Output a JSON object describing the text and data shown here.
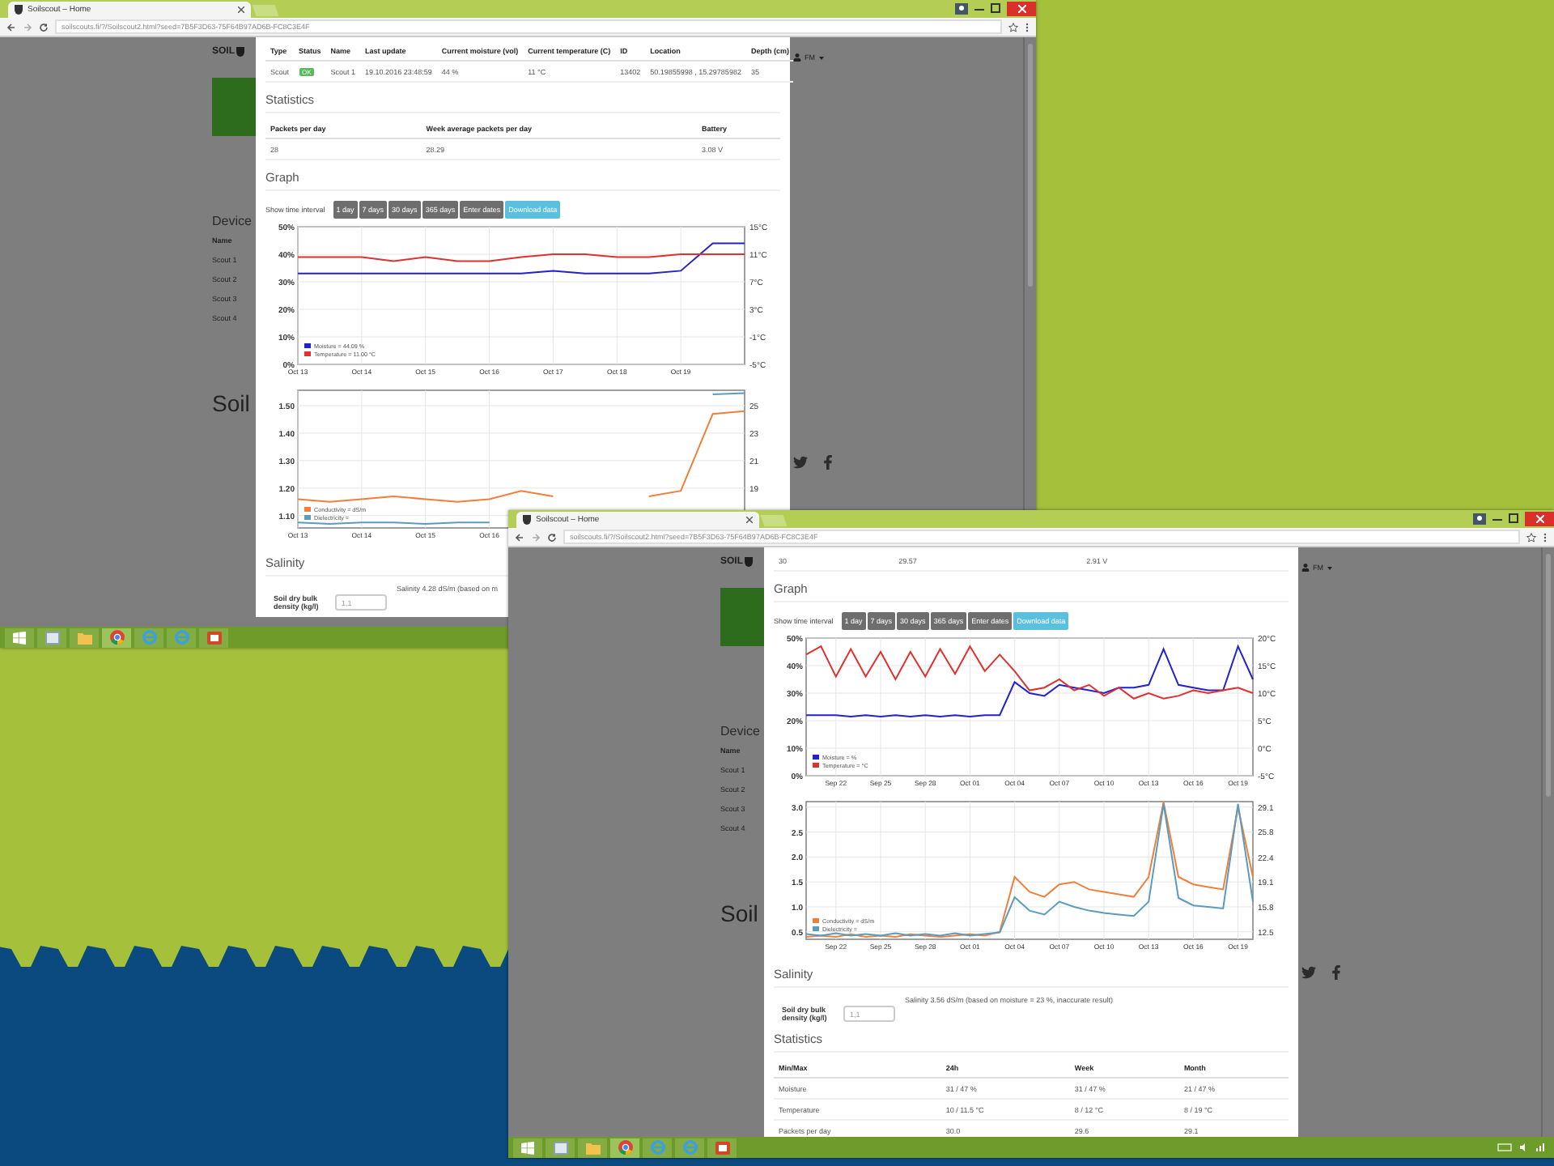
{
  "windows": [
    {
      "tab_title": "Soilscout – Home",
      "url": "soilscouts.fi/?/Soilscout2.html?seed=7B5F3D63-75F64B97AD6B-FC8C3E4F",
      "page": {
        "logo": "SOIL",
        "devices_heading": "Device",
        "devices_column": "Name",
        "devices": [
          "Scout 1",
          "Scout 2",
          "Scout 3",
          "Scout 4"
        ],
        "footer_title": "Soil",
        "user": "FM"
      },
      "modal": [
        {
          "kind": "table",
          "columns": [
            {
              "label": "Type",
              "kind": "text"
            },
            {
              "label": "Status",
              "kind": "badge"
            },
            {
              "label": "Name",
              "kind": "text"
            },
            {
              "label": "Last update",
              "kind": "text"
            },
            {
              "label": "Current moisture (vol)",
              "kind": "text"
            },
            {
              "label": "Current temperature (C)",
              "kind": "text"
            },
            {
              "label": "ID",
              "kind": "text"
            },
            {
              "label": "Location",
              "kind": "text"
            },
            {
              "label": "Depth (cm)",
              "kind": "text"
            }
          ],
          "rows": [
            [
              "Scout",
              "OK",
              "Scout 1",
              "19.10.2016 23:48:59",
              "44 %",
              "11 °C",
              "13402",
              "50.19855998 , 15.29785982",
              "35"
            ]
          ]
        },
        {
          "kind": "heading",
          "text": "Statistics"
        },
        {
          "kind": "table",
          "columns": [
            {
              "label": "Packets per day",
              "kind": "text"
            },
            {
              "label": "Week average packets per day",
              "kind": "text"
            },
            {
              "label": "Battery",
              "kind": "text"
            }
          ],
          "rows": [
            [
              "28",
              "28.29",
              "3.08 V"
            ]
          ]
        },
        {
          "kind": "heading",
          "text": "Graph"
        },
        {
          "kind": "interval",
          "label": "Show time interval",
          "buttons": [
            {
              "label": "1 day",
              "kind": "time"
            },
            {
              "label": "7 days",
              "kind": "time"
            },
            {
              "label": "30 days",
              "kind": "time"
            },
            {
              "label": "365 days",
              "kind": "time"
            },
            {
              "label": "Enter dates",
              "kind": "time"
            },
            {
              "label": "Download data",
              "kind": "download"
            }
          ]
        },
        {
          "kind": "chart",
          "chart_data": {
            "type": "line",
            "categories": [
              "Oct 13",
              null,
              "Oct 14",
              null,
              "Oct 15",
              null,
              "Oct 16",
              null,
              "Oct 17",
              null,
              "Oct 18",
              null,
              "Oct 19",
              null,
              null
            ],
            "grid": true,
            "legend": "lower left",
            "ylim": [
              0,
              50
            ],
            "yticks": [
              {
                "value": 0,
                "label": "0%"
              },
              {
                "value": 10,
                "label": "10%"
              },
              {
                "value": 20,
                "label": "20%"
              },
              {
                "value": 30,
                "label": "30%"
              },
              {
                "value": 40,
                "label": "40%"
              },
              {
                "value": 50,
                "label": "50%"
              }
            ],
            "y2lim": [
              -5,
              15
            ],
            "y2ticks": [
              {
                "value": -5,
                "label": "-5°C"
              },
              {
                "value": -1,
                "label": "-1°C"
              },
              {
                "value": 3,
                "label": "3°C"
              },
              {
                "value": 7,
                "label": "7°C"
              },
              {
                "value": 11,
                "label": "11°C"
              },
              {
                "value": 15,
                "label": "15°C"
              }
            ],
            "series": [
              {
                "name": "Moisture = 44.09 %",
                "color": "#2222cc",
                "values": [
                  33,
                  33,
                  33,
                  33,
                  33,
                  33,
                  33,
                  33,
                  34,
                  33,
                  33,
                  33,
                  34,
                  44,
                  44
                ]
              },
              {
                "name": "Temperature = 11.00 °C",
                "color": "#e03030",
                "axis": "y2",
                "values": [
                  10.6,
                  10.6,
                  10.6,
                  10.0,
                  10.6,
                  10.0,
                  10.0,
                  10.6,
                  11.0,
                  11.0,
                  10.6,
                  10.6,
                  11.0,
                  11.0,
                  11.0
                ]
              }
            ]
          }
        },
        {
          "kind": "chart",
          "chart_data": {
            "type": "line",
            "categories": [
              "Oct 13",
              null,
              "Oct 14",
              null,
              "Oct 15",
              null,
              "Oct 16",
              null,
              null,
              null,
              null,
              null,
              null,
              null,
              null
            ],
            "grid": true,
            "legend": "lower left",
            "ylim": [
              1.055,
              1.556
            ],
            "yticks": [
              {
                "value": 1.1,
                "label": "1.10"
              },
              {
                "value": 1.2,
                "label": "1.20"
              },
              {
                "value": 1.3,
                "label": "1.30"
              },
              {
                "value": 1.4,
                "label": "1.40"
              },
              {
                "value": 1.5,
                "label": "1.50"
              }
            ],
            "y2lim": [
              16.1,
              26.1
            ],
            "y2ticks": [
              {
                "value": 19,
                "label": "19"
              },
              {
                "value": 21,
                "label": "21"
              },
              {
                "value": 23,
                "label": "23"
              },
              {
                "value": 25,
                "label": "25"
              }
            ],
            "series": [
              {
                "name": "Conductivity = dS/m",
                "color": "#f07f3c",
                "values": [
                  1.16,
                  1.15,
                  1.16,
                  1.17,
                  1.16,
                  1.15,
                  1.16,
                  1.19,
                  1.17,
                  null,
                  null,
                  1.17,
                  1.19,
                  1.47,
                  1.48
                ]
              },
              {
                "name": "Dielectricity =",
                "color": "#5b9bbd",
                "axis": "y2",
                "values": [
                  16.5,
                  16.4,
                  16.5,
                  16.5,
                  16.4,
                  16.5,
                  16.5,
                  null,
                  null,
                  null,
                  null,
                  null,
                  null,
                  25.8,
                  25.9
                ]
              }
            ]
          }
        },
        {
          "kind": "heading",
          "text": "Salinity"
        },
        {
          "kind": "salinity",
          "result": "Salinity 4.28 dS/m (based on m",
          "density_label": "Soil dry bulk density (kg/l)",
          "density_value": "1,1"
        }
      ],
      "taskbar": {
        "apps": [
          {
            "kind": "start",
            "selected": false
          },
          {
            "kind": "explorer",
            "selected": false
          },
          {
            "kind": "folder",
            "selected": false
          },
          {
            "kind": "chrome",
            "selected": true
          },
          {
            "kind": "ie",
            "selected": false
          },
          {
            "kind": "ie",
            "selected": false
          },
          {
            "kind": "slides",
            "selected": false
          }
        ]
      }
    },
    {
      "tab_title": "Soilscout – Home",
      "url": "soilscouts.fi/?/Soilscout2.html?seed=7B5F3D63-75F64B97AD6B-FC8C3E4F",
      "page": {
        "logo": "SOIL",
        "devices_heading": "Device",
        "devices_column": "Name",
        "devices": [
          "Scout 1",
          "Scout 2",
          "Scout 3",
          "Scout 4"
        ],
        "footer_title": "Soil",
        "user": "FM"
      },
      "modal": [
        {
          "kind": "table",
          "rows": [
            [
              "30",
              "29.57",
              "2.91 V"
            ]
          ]
        },
        {
          "kind": "heading",
          "text": "Graph"
        },
        {
          "kind": "interval",
          "label": "Show time interval",
          "buttons": [
            {
              "label": "1 day",
              "kind": "time"
            },
            {
              "label": "7 days",
              "kind": "time"
            },
            {
              "label": "30 days",
              "kind": "time"
            },
            {
              "label": "365 days",
              "kind": "time"
            },
            {
              "label": "Enter dates",
              "kind": "time"
            },
            {
              "label": "Download data",
              "kind": "download"
            }
          ]
        },
        {
          "kind": "chart",
          "chart_data": {
            "type": "line",
            "categories": [
              null,
              null,
              "Sep 22",
              null,
              null,
              "Sep 25",
              null,
              null,
              "Sep 28",
              null,
              null,
              "Oct 01",
              null,
              null,
              "Oct 04",
              null,
              null,
              "Oct 07",
              null,
              null,
              "Oct 10",
              null,
              null,
              "Oct 13",
              null,
              null,
              "Oct 16",
              null,
              null,
              "Oct 19",
              null
            ],
            "grid": true,
            "legend": "lower left",
            "ylim": [
              0,
              50
            ],
            "yticks": [
              {
                "value": 0,
                "label": "0%"
              },
              {
                "value": 10,
                "label": "10%"
              },
              {
                "value": 20,
                "label": "20%"
              },
              {
                "value": 30,
                "label": "30%"
              },
              {
                "value": 40,
                "label": "40%"
              },
              {
                "value": 50,
                "label": "50%"
              }
            ],
            "y2lim": [
              -5,
              20
            ],
            "y2ticks": [
              {
                "value": -5,
                "label": "-5°C"
              },
              {
                "value": 0,
                "label": "0°C"
              },
              {
                "value": 5,
                "label": "5°C"
              },
              {
                "value": 10,
                "label": "10°C"
              },
              {
                "value": 15,
                "label": "15°C"
              },
              {
                "value": 20,
                "label": "20°C"
              }
            ],
            "series": [
              {
                "name": "Moisture = %",
                "color": "#2222cc",
                "values": [
                  22,
                  22,
                  22,
                  21.5,
                  22,
                  21.5,
                  22,
                  21.5,
                  22,
                  21.5,
                  22,
                  21.5,
                  22,
                  22,
                  34,
                  30,
                  29,
                  33,
                  32,
                  31,
                  30,
                  32,
                  32,
                  33,
                  46,
                  33,
                  32,
                  31,
                  31,
                  47,
                  35
                ]
              },
              {
                "name": "Temperature = °C",
                "color": "#e03030",
                "axis": "y2",
                "values": [
                  17,
                  18.5,
                  13,
                  18,
                  13,
                  17.5,
                  12.5,
                  17.5,
                  13,
                  18,
                  13.5,
                  18.5,
                  14,
                  17,
                  14,
                  10.5,
                  11,
                  12.5,
                  10.5,
                  11.5,
                  9.5,
                  11,
                  9,
                  10,
                  9,
                  9.5,
                  10.5,
                  10,
                  10.5,
                  11,
                  10
                ]
              }
            ]
          }
        },
        {
          "kind": "chart",
          "chart_data": {
            "type": "line",
            "categories": [
              null,
              null,
              "Sep 22",
              null,
              null,
              "Sep 25",
              null,
              null,
              "Sep 28",
              null,
              null,
              "Oct 01",
              null,
              null,
              "Oct 04",
              null,
              null,
              "Oct 07",
              null,
              null,
              "Oct 10",
              null,
              null,
              "Oct 13",
              null,
              null,
              "Oct 16",
              null,
              null,
              "Oct 19",
              null
            ],
            "grid": true,
            "legend": "lower left",
            "ylim": [
              0.35,
              3.11
            ],
            "yticks": [
              {
                "value": 0.5,
                "label": "0.5"
              },
              {
                "value": 1,
                "label": "1.0"
              },
              {
                "value": 1.5,
                "label": "1.5"
              },
              {
                "value": 2,
                "label": "2.0"
              },
              {
                "value": 2.5,
                "label": "2.5"
              },
              {
                "value": 3,
                "label": "3.0"
              }
            ],
            "y2lim": [
              11.5,
              29.8
            ],
            "y2ticks": [
              {
                "value": 12.5,
                "label": "12.5"
              },
              {
                "value": 15.8,
                "label": "15.8"
              },
              {
                "value": 19.1,
                "label": "19.1"
              },
              {
                "value": 22.4,
                "label": "22.4"
              },
              {
                "value": 25.8,
                "label": "25.8"
              },
              {
                "value": 29.1,
                "label": "29.1"
              }
            ],
            "series": [
              {
                "name": "Conductivity = dS/m",
                "color": "#f07f3c",
                "values": [
                  0.4,
                  0.42,
                  0.4,
                  0.45,
                  0.4,
                  0.42,
                  0.4,
                  0.45,
                  0.42,
                  0.4,
                  0.42,
                  0.45,
                  0.42,
                  0.5,
                  1.6,
                  1.3,
                  1.2,
                  1.45,
                  1.5,
                  1.35,
                  1.3,
                  1.25,
                  1.2,
                  1.6,
                  3.1,
                  1.6,
                  1.45,
                  1.4,
                  1.35,
                  3.0,
                  1.6
                ]
              },
              {
                "name": "Dielectricity =",
                "color": "#5b9bbd",
                "axis": "y2",
                "values": [
                  12.2,
                  12.0,
                  12.3,
                  12.0,
                  12.2,
                  12.0,
                  12.3,
                  12.0,
                  12.2,
                  12.0,
                  12.3,
                  12.0,
                  12.2,
                  12.4,
                  17.1,
                  15.3,
                  14.8,
                  16.5,
                  15.8,
                  15.3,
                  15.0,
                  14.8,
                  14.6,
                  16.5,
                  29.5,
                  17.0,
                  16.0,
                  15.8,
                  15.6,
                  29.5,
                  16.5
                ]
              }
            ]
          }
        },
        {
          "kind": "heading",
          "text": "Salinity"
        },
        {
          "kind": "salinity",
          "result": "Salinity 3.56 dS/m (based on moisture = 23 %, inaccurate result)",
          "density_label": "Soil dry bulk density (kg/l)",
          "density_value": "1,1"
        },
        {
          "kind": "heading",
          "text": "Statistics"
        },
        {
          "kind": "table",
          "columns": [
            {
              "label": "Min/Max",
              "kind": "text"
            },
            {
              "label": "24h",
              "kind": "text"
            },
            {
              "label": "Week",
              "kind": "text"
            },
            {
              "label": "Month",
              "kind": "text"
            }
          ],
          "rows": [
            [
              "Moisture",
              "31 / 47 %",
              "31 / 47 %",
              "21 / 47 %"
            ],
            [
              "Temperature",
              "10 / 11.5 °C",
              "8 / 12 °C",
              "8 / 19 °C"
            ],
            [
              "Packets per day",
              "30.0",
              "29.6",
              "29.1"
            ]
          ]
        }
      ],
      "taskbar": {
        "apps": [
          {
            "kind": "start",
            "selected": false
          },
          {
            "kind": "explorer",
            "selected": false
          },
          {
            "kind": "folder",
            "selected": false
          },
          {
            "kind": "chrome",
            "selected": true
          },
          {
            "kind": "ie",
            "selected": false
          },
          {
            "kind": "ie",
            "selected": false
          },
          {
            "kind": "slides",
            "selected": false
          }
        ],
        "tray": true
      }
    }
  ]
}
